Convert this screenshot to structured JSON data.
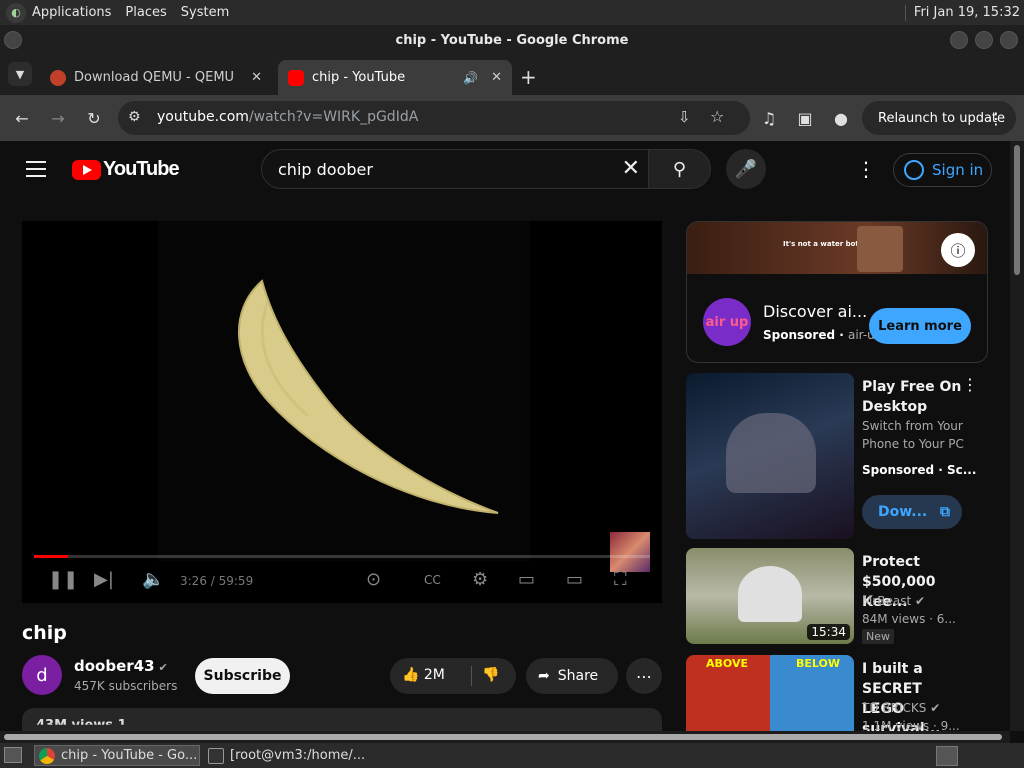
{
  "panel": {
    "menus": [
      "Applications",
      "Places",
      "System"
    ],
    "clock": "Fri Jan 19, 15:32"
  },
  "window": {
    "title": "chip - YouTube - Google Chrome"
  },
  "tabs": [
    {
      "label": "Download QEMU - QEMU"
    },
    {
      "label": "chip - YouTube"
    }
  ],
  "toolbar": {
    "url_host": "youtube.com",
    "url_path": "/watch?v=WIRK_pGdIdA",
    "relaunch": "Relaunch to update"
  },
  "youtube": {
    "logo": "YouTube",
    "search": "chip doober",
    "signin": "Sign in",
    "video": {
      "title": "chip",
      "time": "3:26 / 59:59",
      "progress": 0.055
    },
    "channel": {
      "avatar": "d",
      "name": "doober43",
      "subs": "457K subscribers",
      "subscribe": "Subscribe"
    },
    "actions": {
      "likes": "2M",
      "share": "Share"
    },
    "desc_partial": "43M views  1..."
  },
  "ad": {
    "banner": "It's not a water bottle.",
    "logo": "air up",
    "title": "Discover ai...",
    "sponsored": "Sponsored",
    "domain": "air-u",
    "cta": "Learn more"
  },
  "recs": [
    {
      "title": "Play Free On Desktop",
      "line1": "Switch from Your",
      "line2": "Phone to Your PC",
      "line3": "Sponsored · Sc...",
      "cta": "Dow..."
    },
    {
      "title": "Protect $500,000 Kee...",
      "channel": "MrBeast",
      "views": "84M views · 6...",
      "duration": "15:34",
      "badge": "New"
    },
    {
      "title": "I built a SECRET LEGO survival...",
      "channel": "TD BRICKS",
      "views": "1.1M views · 9..."
    }
  ],
  "taskbar": [
    {
      "label": "chip - YouTube - Go..."
    },
    {
      "label": "[root@vm3:/home/..."
    }
  ]
}
